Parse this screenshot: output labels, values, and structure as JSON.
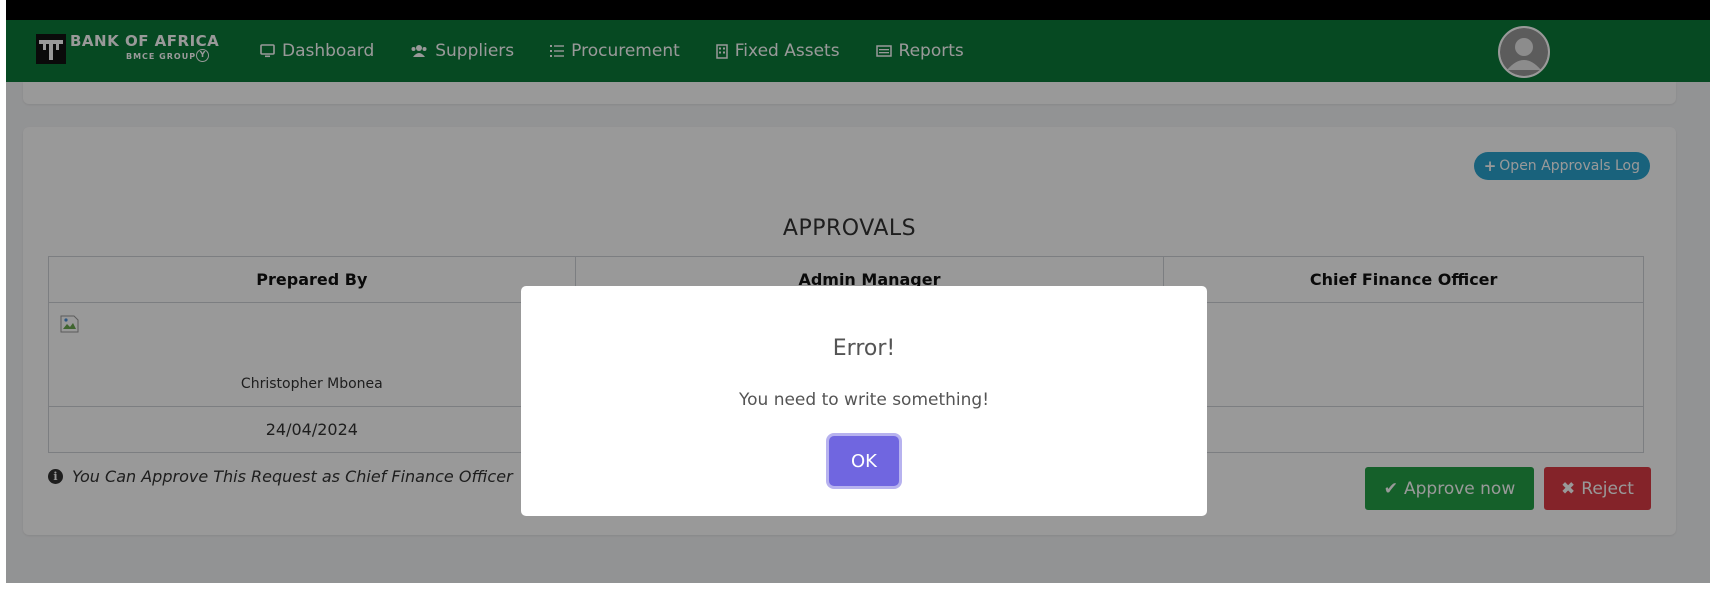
{
  "brand": {
    "name": "BANK OF AFRICA",
    "sub": "BMCE GROUP"
  },
  "nav": {
    "items": [
      {
        "label": "Dashboard",
        "icon": "monitor-icon"
      },
      {
        "label": "Suppliers",
        "icon": "users-icon"
      },
      {
        "label": "Procurement",
        "icon": "list-icon"
      },
      {
        "label": "Fixed Assets",
        "icon": "building-icon"
      },
      {
        "label": "Reports",
        "icon": "report-icon"
      }
    ]
  },
  "approvals": {
    "log_button": "Open Approvals Log",
    "title": "APPROVALS",
    "columns": [
      "Prepared By",
      "Admin Manager",
      "Chief Finance Officer"
    ],
    "prepared_by": {
      "name": "Christopher Mbonea",
      "date": "24/04/2024"
    },
    "note": "You Can Approve This Request as Chief Finance Officer",
    "approve_label": "Approve now",
    "reject_label": "Reject"
  },
  "modal": {
    "title": "Error!",
    "text": "You need to write something!",
    "ok_label": "OK"
  },
  "colors": {
    "navbar": "#0a7a3a",
    "approve": "#24a046",
    "reject": "#dc3b45",
    "info_button": "#2aa3cf",
    "modal_confirm": "#7066e0"
  }
}
